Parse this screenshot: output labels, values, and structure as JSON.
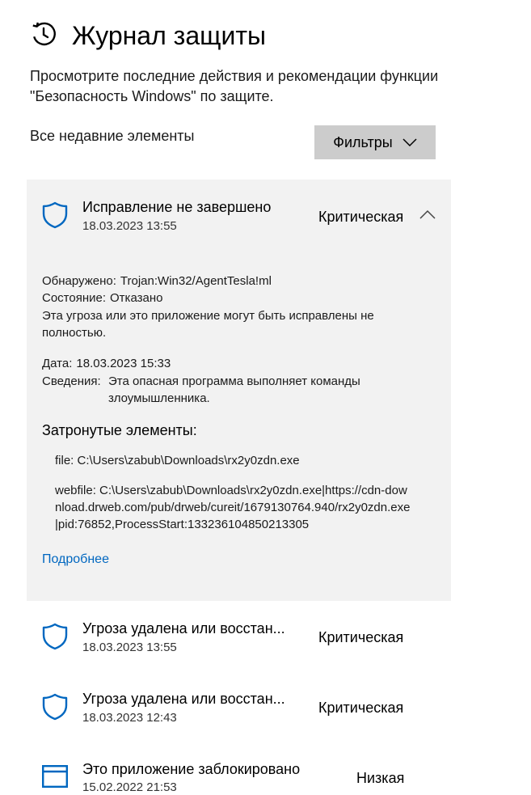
{
  "header": {
    "title": "Журнал защиты",
    "description": "Просмотрите последние действия и рекомендации функции \"Безопасность Windows\" по защите.",
    "section_label": "Все недавние элементы",
    "filters_label": "Фильтры"
  },
  "expanded_item": {
    "title": "Исправление не завершено",
    "date": "18.03.2023 13:55",
    "severity": "Критическая",
    "detected_label": "Обнаружено:",
    "detected_value": "Trojan:Win32/AgentTesla!ml",
    "status_label": "Состояние:",
    "status_value": "Отказано",
    "warning_text": "Эта угроза или это приложение могут быть исправлены не полностью.",
    "date_label": "Дата:",
    "date_value": "18.03.2023 15:33",
    "details_label": "Сведения:",
    "details_value": "Эта опасная программа выполняет команды злоумышленника.",
    "affected_title": "Затронутые элементы:",
    "affected": [
      "file: C:\\Users\\zabub\\Downloads\\rx2y0zdn.exe",
      "webfile: C:\\Users\\zabub\\Downloads\\rx2y0zdn.exe|https://cdn-download.drweb.com/pub/drweb/cureit/1679130764.940/rx2y0zdn.exe|pid:76852,ProcessStart:133236104850213305"
    ],
    "more_link": "Подробнее"
  },
  "items": [
    {
      "title": "Угроза удалена или восстан...",
      "date": "18.03.2023 13:55",
      "severity": "Критическая",
      "icon": "shield-icon"
    },
    {
      "title": "Угроза удалена или восстан...",
      "date": "18.03.2023 12:43",
      "severity": "Критическая",
      "icon": "shield-icon"
    },
    {
      "title": "Это приложение заблокировано",
      "date": "15.02.2022 21:53",
      "severity": "Низкая",
      "icon": "app-window-icon"
    }
  ],
  "colors": {
    "accent": "#0067c0",
    "card_bg": "#f2f2f2",
    "button_bg": "#cccccc"
  }
}
